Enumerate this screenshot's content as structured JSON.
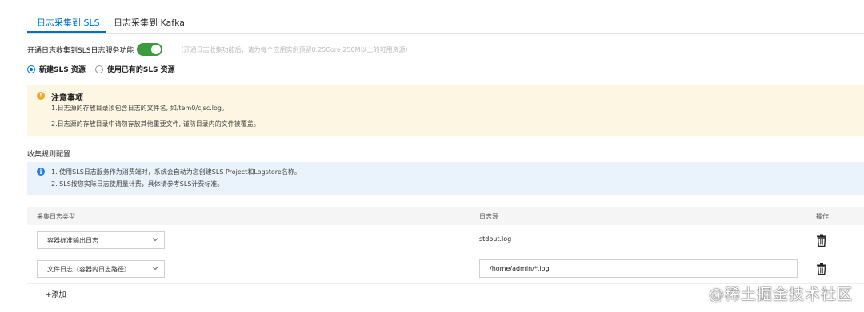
{
  "tabs": [
    {
      "label": "日志采集到 SLS",
      "active": true
    },
    {
      "label": "日志采集到 Kafka",
      "active": false
    }
  ],
  "toggle": {
    "label": "开通日志收集到SLS日志服务功能",
    "on": true,
    "hint": "（开通日志收集功能后，请为每个应用实例预留0.25Core 250M以上的可用资源）"
  },
  "resource_options": [
    {
      "label": "新建SLS 资源",
      "selected": true
    },
    {
      "label": "使用已有的SLS 资源",
      "selected": false
    }
  ],
  "notice": {
    "title": "注意事项",
    "lines": [
      "1.日志源的存放目录须包含日志的文件名, 如/tem0/cjsc.log。",
      "2.日志源的存放目录中请勿存放其他重要文件, 谨防目录内的文件被覆盖。"
    ]
  },
  "section_title": "收集规则配置",
  "info": {
    "lines": [
      "1. 使用SLS日志服务作为消费端时，系统会自动为您创建SLS Project和Logstore名称。",
      "2. SLS按您实际日志使用量计费，具体请参考SLS计费标准。"
    ]
  },
  "table": {
    "columns": [
      "采集日志类型",
      "日志源",
      "操作"
    ],
    "rows": [
      {
        "type": "容器标准输出日志",
        "source": "stdout.log",
        "editable": false
      },
      {
        "type": "文件日志（容器内日志路径）",
        "source": "/home/admin/*.log",
        "editable": true
      }
    ]
  },
  "add_label": "+添加",
  "watermark": "@稀土掘金技术社区",
  "colors": {
    "accent": "#0070cc",
    "switch_on": "#3c9a3f",
    "warning_bg": "#fdf6e3",
    "info_bg": "#eaf3fc"
  }
}
